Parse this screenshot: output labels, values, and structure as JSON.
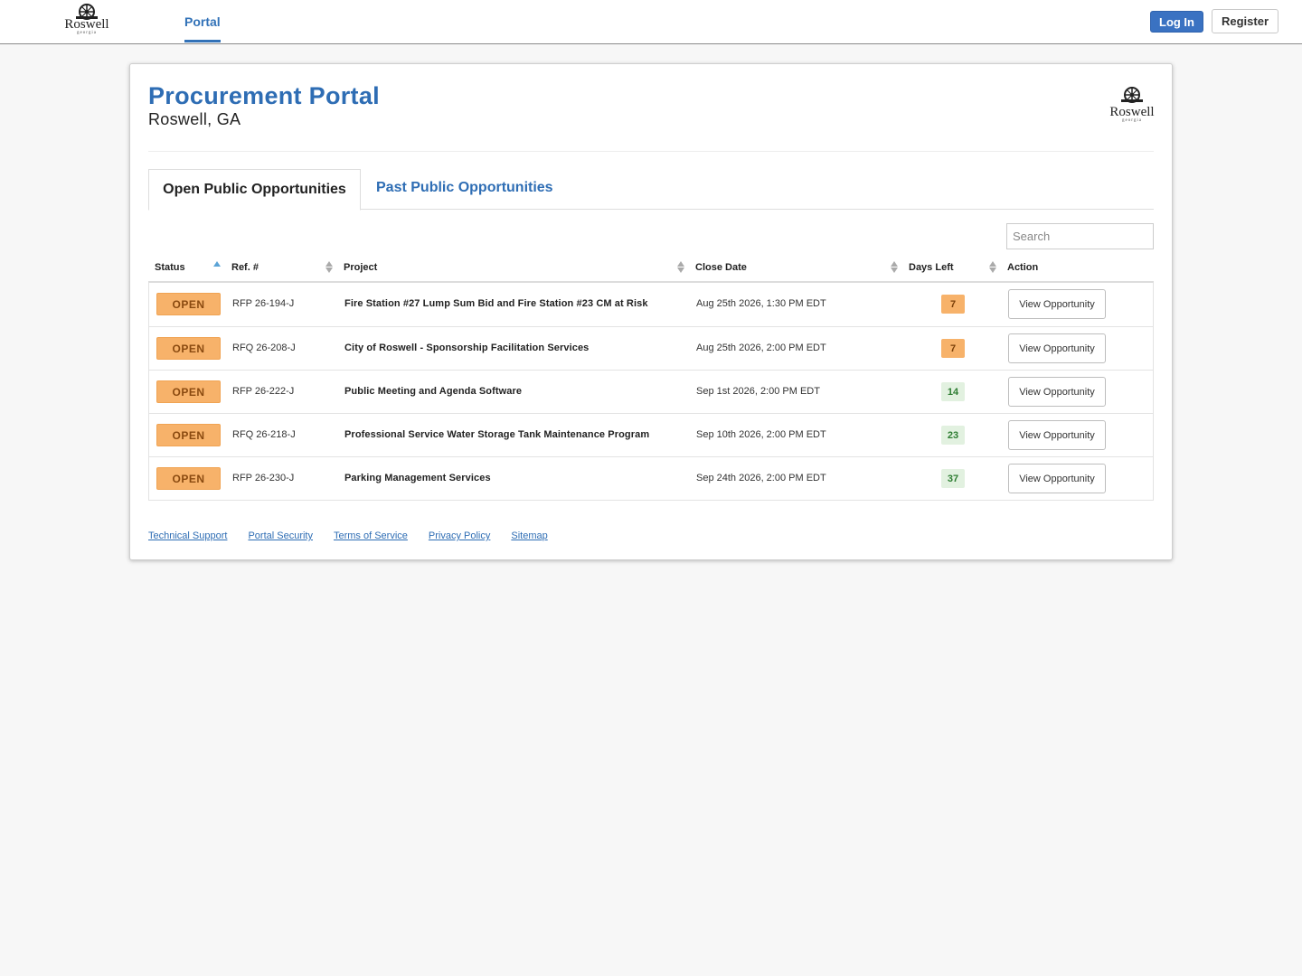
{
  "header": {
    "logo_text": "Roswell",
    "logo_subtext": "georgia",
    "nav_portal": "Portal",
    "login_label": "Log In",
    "register_label": "Register"
  },
  "page": {
    "title": "Procurement Portal",
    "subtitle": "Roswell, GA"
  },
  "tabs": [
    {
      "label": "Open Public Opportunities",
      "active": true
    },
    {
      "label": "Past Public Opportunities",
      "active": false
    }
  ],
  "search": {
    "placeholder": "Search",
    "value": ""
  },
  "table": {
    "headers": {
      "status": "Status",
      "ref": "Ref. #",
      "project": "Project",
      "close_date": "Close Date",
      "days_left": "Days Left",
      "action": "Action"
    },
    "rows": [
      {
        "status": "OPEN",
        "ref": "RFP 26-194-J",
        "project": "Fire Station #27 Lump Sum Bid and Fire Station #23 CM at Risk",
        "close_date": "Aug 25th 2026, 1:30 PM EDT",
        "days_left": "7",
        "action": "View Opportunity"
      },
      {
        "status": "OPEN",
        "ref": "RFQ 26-208-J",
        "project": "City of Roswell - Sponsorship Facilitation Services",
        "close_date": "Aug 25th 2026, 2:00 PM EDT",
        "days_left": "7",
        "action": "View Opportunity"
      },
      {
        "status": "OPEN",
        "ref": "RFP 26-222-J",
        "project": "Public Meeting and Agenda Software",
        "close_date": "Sep 1st 2026, 2:00 PM EDT",
        "days_left": "14",
        "action": "View Opportunity"
      },
      {
        "status": "OPEN",
        "ref": "RFQ 26-218-J",
        "project": "Professional Service Water Storage Tank Maintenance Program",
        "close_date": "Sep 10th 2026, 2:00 PM EDT",
        "days_left": "23",
        "action": "View Opportunity"
      },
      {
        "status": "OPEN",
        "ref": "RFP 26-230-J",
        "project": "Parking Management Services",
        "close_date": "Sep 24th 2026, 2:00 PM EDT",
        "days_left": "37",
        "action": "View Opportunity"
      }
    ]
  },
  "footer": {
    "links": [
      "Technical Support",
      "Portal Security",
      "Terms of Service",
      "Privacy Policy",
      "Sitemap"
    ]
  },
  "colors": {
    "brand_blue": "#2e6db4",
    "status_open": "#f7b26a",
    "days_ok": "#e2f1e0"
  }
}
